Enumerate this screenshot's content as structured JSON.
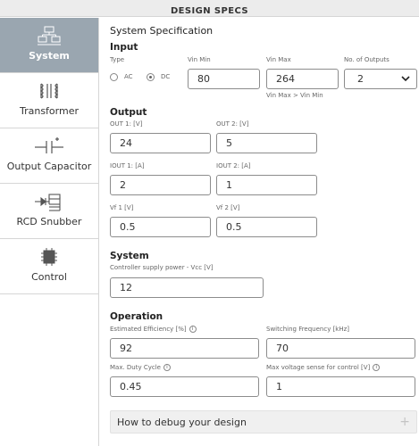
{
  "header": {
    "title": "DESIGN SPECS"
  },
  "sidebar": {
    "items": [
      {
        "label": "System",
        "icon": "system-icon",
        "active": true
      },
      {
        "label": "Transformer",
        "icon": "transformer-icon"
      },
      {
        "label": "Output Capacitor",
        "icon": "capacitor-icon"
      },
      {
        "label": "RCD Snubber",
        "icon": "snubber-icon"
      },
      {
        "label": "Control",
        "icon": "chip-icon"
      }
    ]
  },
  "main": {
    "title": "System Specification",
    "input": {
      "heading": "Input",
      "type_label": "Type",
      "type_options": [
        "AC",
        "DC"
      ],
      "type_selected": "DC",
      "vin_min_label": "Vin Min",
      "vin_min": "80",
      "vin_max_label": "Vin Max",
      "vin_max": "264",
      "vin_note": "Vin Max > Vin Min",
      "outputs_label": "No. of Outputs",
      "outputs": "2"
    },
    "output": {
      "heading": "Output",
      "out1_label": "OUT 1: [V]",
      "out1": "24",
      "out2_label": "OUT 2: [V]",
      "out2": "5",
      "iout1_label": "IOUT 1: [A]",
      "iout1": "2",
      "iout2_label": "IOUT 2: [A]",
      "iout2": "1",
      "vf1_label": "Vf 1 [V]",
      "vf1": "0.5",
      "vf2_label": "Vf 2 [V]",
      "vf2": "0.5"
    },
    "system": {
      "heading": "System",
      "vcc_label": "Controller supply power - Vcc [V]",
      "vcc": "12"
    },
    "operation": {
      "heading": "Operation",
      "eff_label": "Estimated Efficiency [%]",
      "eff": "92",
      "fsw_label": "Switching Frequency [kHz]",
      "fsw": "70",
      "duty_label": "Max. Duty Cycle",
      "duty": "0.45",
      "vsense_label": "Max voltage sense for control [V]",
      "vsense": "1"
    },
    "accordion": {
      "label": "How to debug your design"
    }
  },
  "colors": {
    "sidebar_active": "#9aa6b0",
    "border": "#8c8c8c",
    "accordion_bg": "#f0f0f0"
  }
}
